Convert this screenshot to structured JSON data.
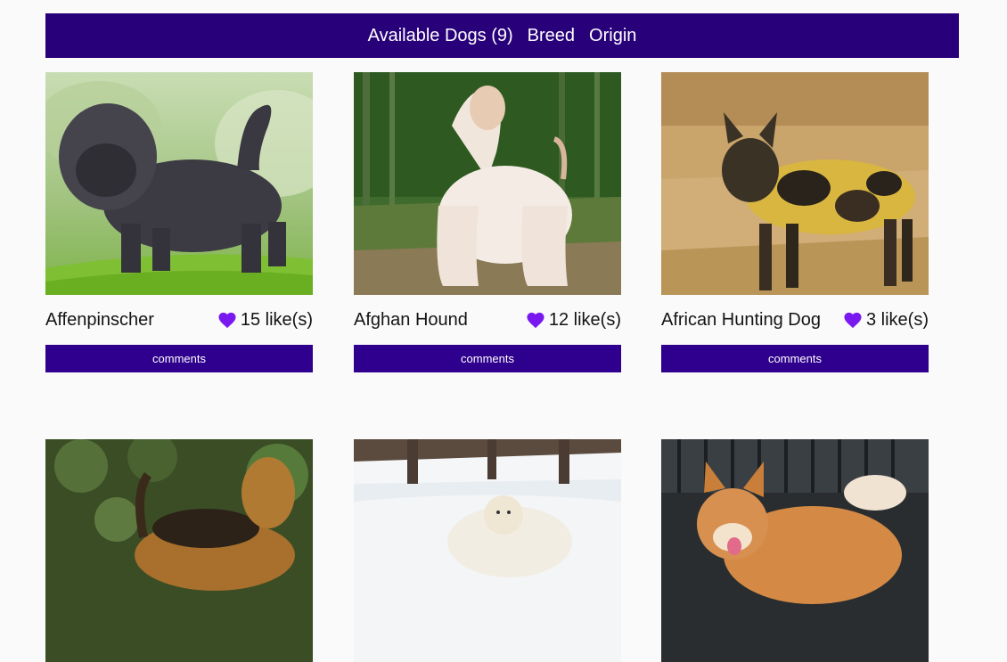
{
  "nav": {
    "available_label": "Available Dogs (9)",
    "breed_label": "Breed",
    "origin_label": "Origin"
  },
  "colors": {
    "nav_background": "#280079",
    "button_background": "#2f008d",
    "heart": "#7a18f0",
    "page_background": "#fafafa"
  },
  "dogs": [
    {
      "name": "Affenpinscher",
      "likes": "15 like(s)",
      "button": "comments"
    },
    {
      "name": "Afghan Hound",
      "likes": "12 like(s)",
      "button": "comments"
    },
    {
      "name": "African Hunting Dog",
      "likes": "3 like(s)",
      "button": "comments"
    },
    {
      "name": "",
      "likes": "",
      "button": ""
    },
    {
      "name": "",
      "likes": "",
      "button": ""
    },
    {
      "name": "",
      "likes": "",
      "button": ""
    }
  ]
}
